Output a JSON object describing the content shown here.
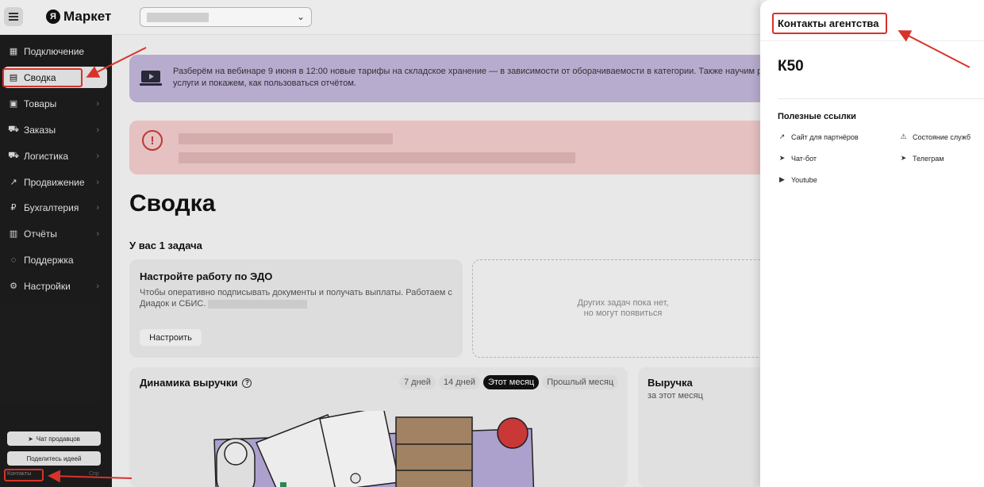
{
  "topbar": {
    "logo_mark": "Я",
    "logo_text": "Маркет"
  },
  "sidebar": {
    "items": [
      {
        "label": "Подключение",
        "icon": "store-icon",
        "glyph": "▦",
        "arrow": false
      },
      {
        "label": "Сводка",
        "icon": "dashboard-icon",
        "glyph": "▤",
        "arrow": false,
        "active": true
      },
      {
        "label": "Товары",
        "icon": "box-icon",
        "glyph": "▣",
        "arrow": true
      },
      {
        "label": "Заказы",
        "icon": "cart-icon",
        "glyph": "⛟",
        "arrow": true
      },
      {
        "label": "Логистика",
        "icon": "truck-icon",
        "glyph": "⛟",
        "arrow": true
      },
      {
        "label": "Продвижение",
        "icon": "chart-icon",
        "glyph": "↗",
        "arrow": true
      },
      {
        "label": "Бухгалтерия",
        "icon": "ruble-icon",
        "glyph": "₽",
        "arrow": true
      },
      {
        "label": "Отчёты",
        "icon": "report-icon",
        "glyph": "▥",
        "arrow": true
      },
      {
        "label": "Поддержка",
        "icon": "chat-icon",
        "glyph": "◌",
        "arrow": false
      },
      {
        "label": "Настройки",
        "icon": "gear-icon",
        "glyph": "⚙",
        "arrow": true
      }
    ],
    "chat_button": "Чат продавцов",
    "idea_button": "Поделитесь идеей",
    "contacts_link": "Контакты",
    "help_link": "Спр"
  },
  "main": {
    "banner_text": "Разберём на вебинаре 9 июня в 12:00 новые тарифы на складское хранение — в зависимости от оборачиваемости в категории. Также научим раб услуги и покажем, как пользоваться отчётом.",
    "page_title": "Сводка",
    "tasks_heading": "У вас 1 задача",
    "task": {
      "title": "Настройте работу по ЭДО",
      "description": "Чтобы оперативно подписывать документы и получать выплаты. Работаем с Диадок и СБИС.",
      "button": "Настроить"
    },
    "empty_tasks": {
      "line1": "Других задач пока нет,",
      "line2": "но могут появиться"
    },
    "revenue_dynamics": {
      "title": "Динамика выручки",
      "periods": [
        "7 дней",
        "14 дней",
        "Этот месяц",
        "Прошлый месяц"
      ],
      "active_period": "Этот месяц"
    },
    "revenue": {
      "title": "Выручка",
      "subtitle": "за этот месяц"
    }
  },
  "panel": {
    "title": "Контакты агентства",
    "agency_code": "К50",
    "links_heading": "Полезные ссылки",
    "links": [
      {
        "label": "Сайт для партнёров",
        "icon": "external-link-icon",
        "glyph": "↗"
      },
      {
        "label": "Состояние служб",
        "icon": "warning-icon",
        "glyph": "⚠"
      },
      {
        "label": "Чат-бот",
        "icon": "telegram-icon",
        "glyph": "➤"
      },
      {
        "label": "Телеграм",
        "icon": "telegram-icon",
        "glyph": "➤"
      },
      {
        "label": "Youtube",
        "icon": "youtube-icon",
        "glyph": "▶"
      }
    ]
  },
  "colors": {
    "accent_red": "#d9322a",
    "sidebar_bg": "#1d1d1d",
    "banner_bg": "#bfb4d7",
    "alert_bg": "#f0c9c9"
  }
}
